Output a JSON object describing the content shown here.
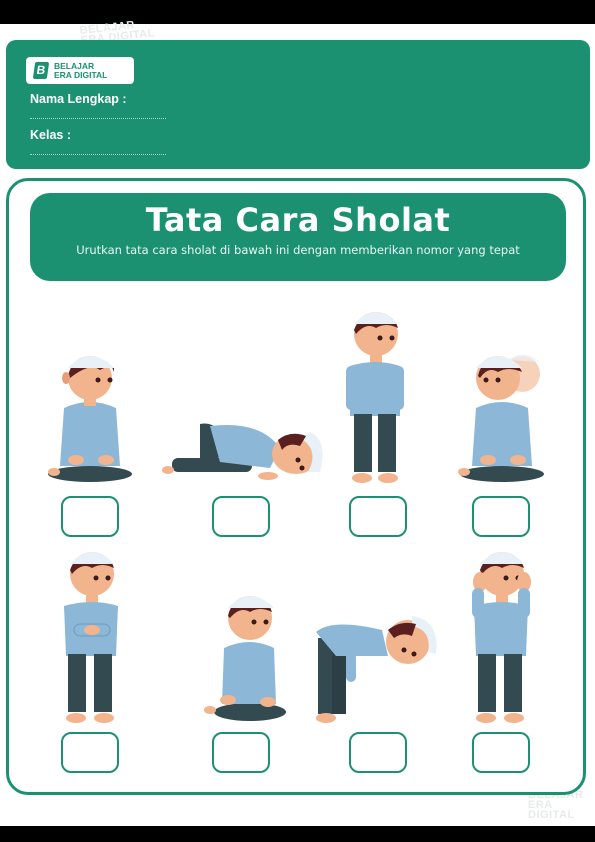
{
  "brand": {
    "line1": "BELAJAR",
    "line2": "ERA DIGITAL",
    "mark": "B"
  },
  "form": {
    "name_label": "Nama Lengkap :",
    "class_label": "Kelas :"
  },
  "worksheet": {
    "title": "Tata Cara Sholat",
    "instruction": "Urutkan tata cara sholat di bawah ini dengan memberikan nomor yang tepat"
  },
  "colors": {
    "primary": "#1b9172",
    "cap": "#e8f1f7",
    "shirt": "#8db7d7",
    "pants": "#334a50",
    "skin": "#f2b48c",
    "hair": "#5a1f1f"
  },
  "figures": [
    {
      "pose": "duduk-tahiyat"
    },
    {
      "pose": "sujud"
    },
    {
      "pose": "berdiri-iktidal"
    },
    {
      "pose": "salam"
    },
    {
      "pose": "berdiri-bersedekap"
    },
    {
      "pose": "duduk-antara-dua-sujud"
    },
    {
      "pose": "ruku"
    },
    {
      "pose": "takbiratul-ihram"
    }
  ]
}
